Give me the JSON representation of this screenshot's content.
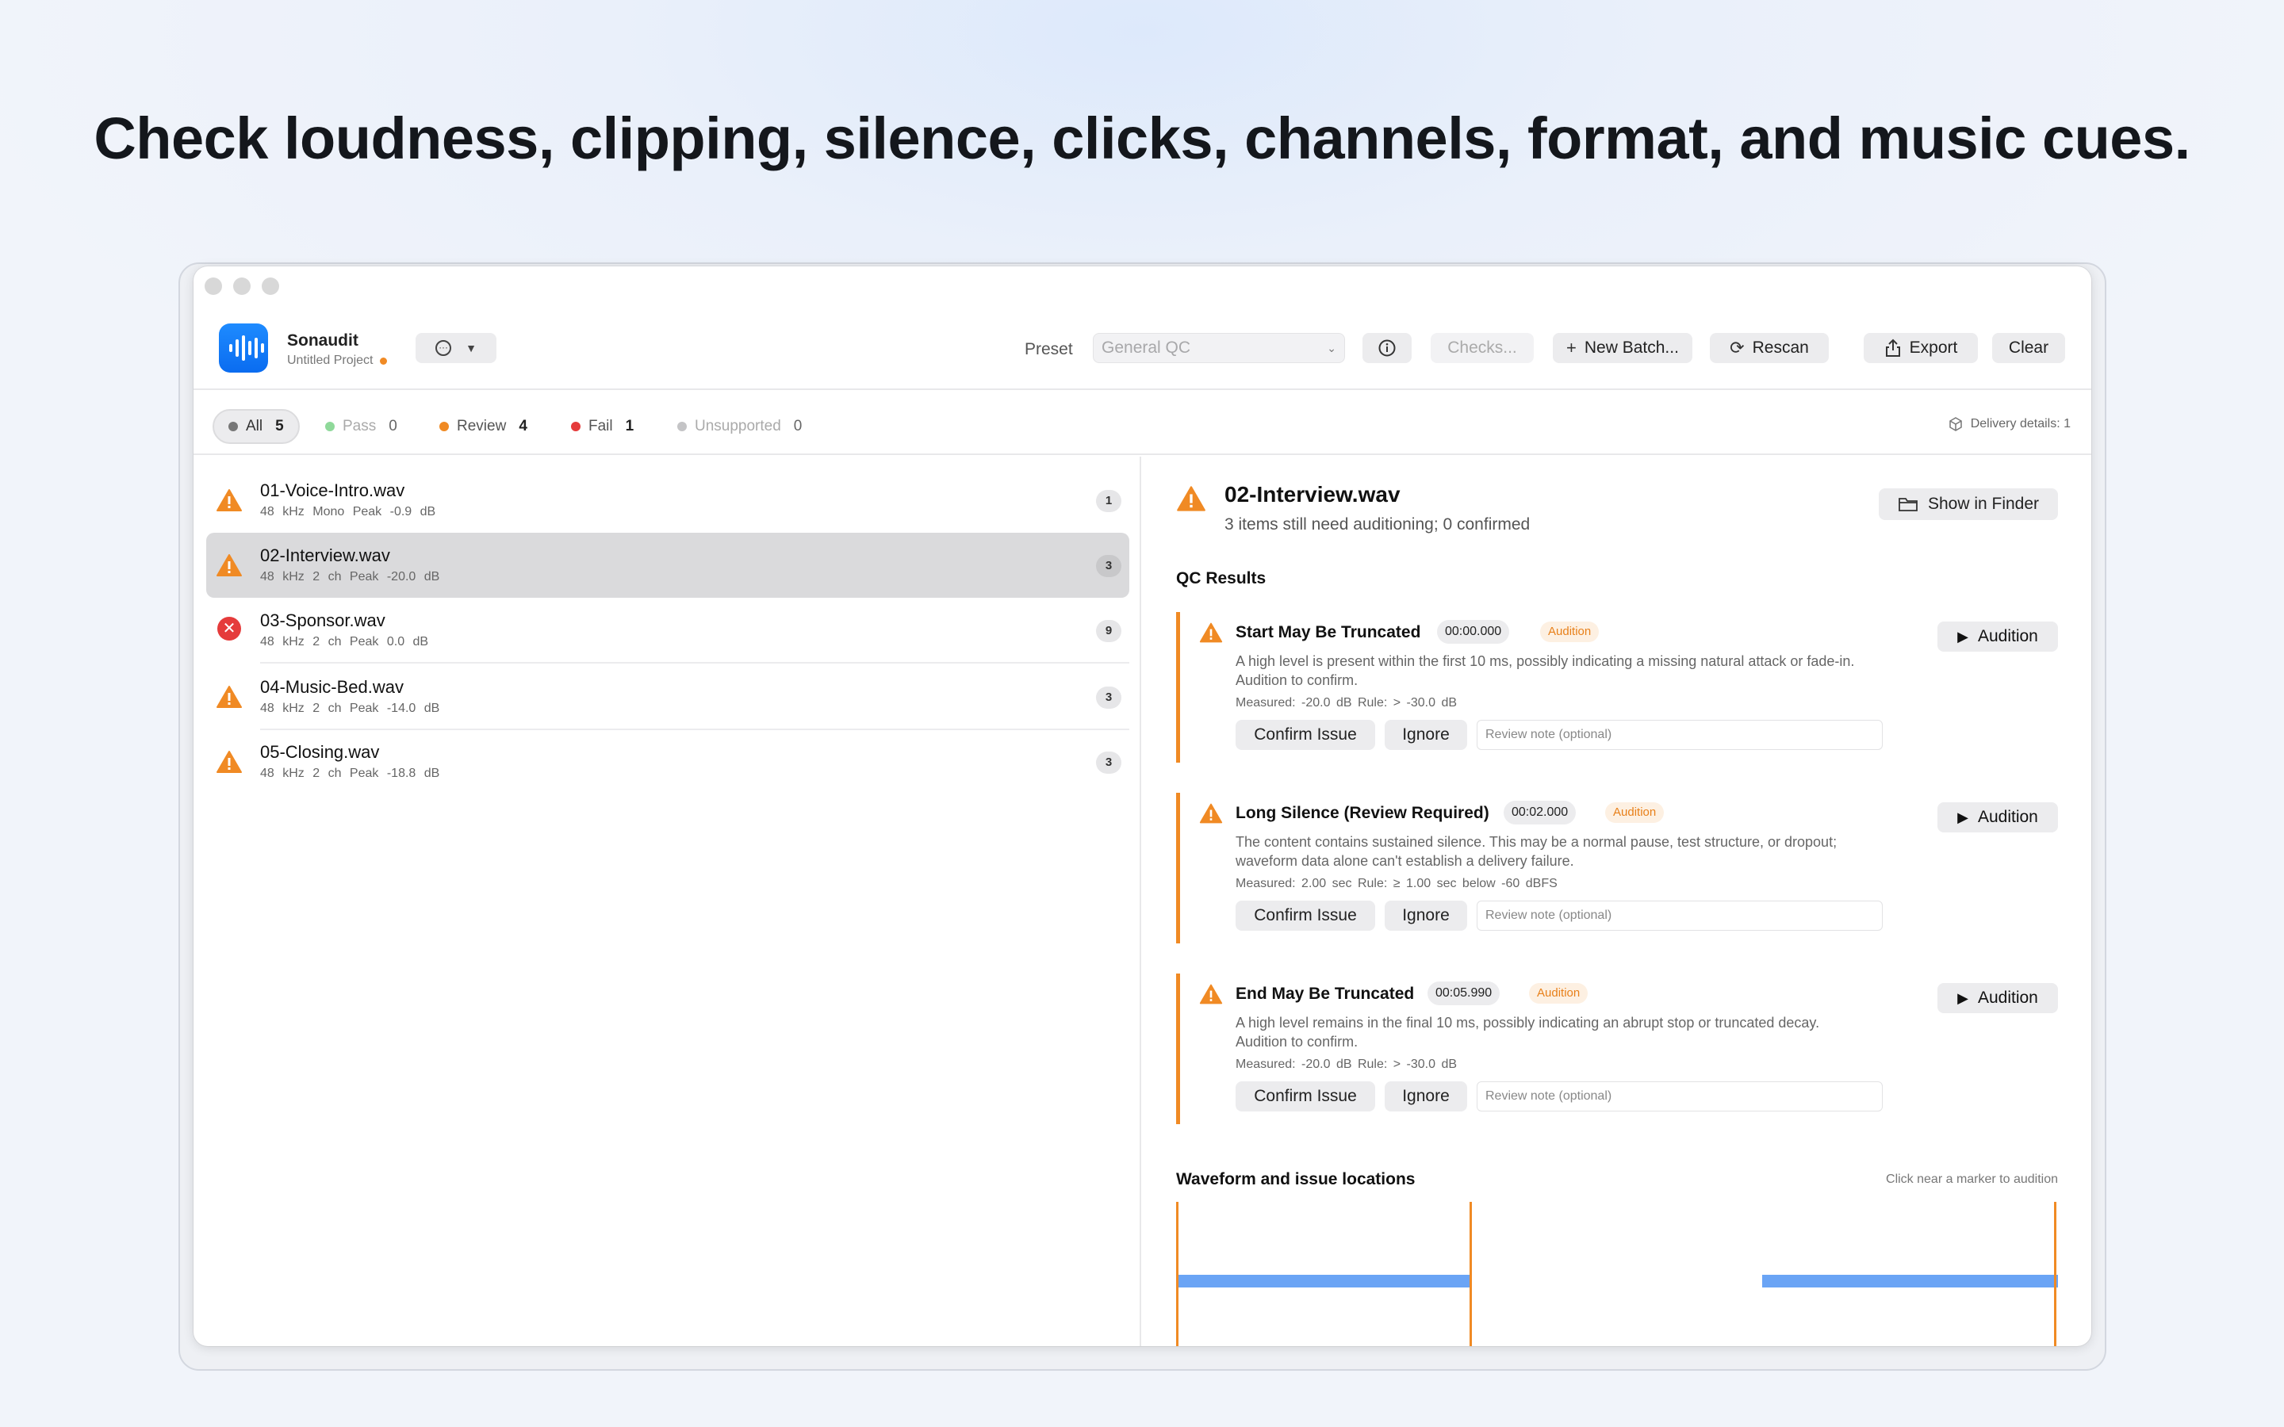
{
  "headline": "Check loudness, clipping, silence, clicks, channels, format, and music cues.",
  "app": {
    "name": "Sonaudit",
    "project": "Untitled Project"
  },
  "toolbar": {
    "preset_label": "Preset",
    "preset_value": "General QC",
    "checks_label": "Checks...",
    "new_batch_label": "New Batch...",
    "rescan_label": "Rescan",
    "export_label": "Export",
    "clear_label": "Clear"
  },
  "filters": [
    {
      "label": "All",
      "count": "5",
      "color": "#777777"
    },
    {
      "label": "Pass",
      "count": "0",
      "color": "#8fd99a"
    },
    {
      "label": "Review",
      "count": "4",
      "color": "#f08a24"
    },
    {
      "label": "Fail",
      "count": "1",
      "color": "#e53b3b"
    },
    {
      "label": "Unsupported",
      "count": "0",
      "color": "#c4c4c6"
    }
  ],
  "delivery_details": "Delivery details: 1",
  "files": [
    {
      "name": "01-Voice-Intro.wav",
      "meta": "48 kHz  Mono  Peak -0.9 dB",
      "count": "1",
      "status": "review"
    },
    {
      "name": "02-Interview.wav",
      "meta": "48 kHz  2 ch  Peak -20.0 dB",
      "count": "3",
      "status": "review"
    },
    {
      "name": "03-Sponsor.wav",
      "meta": "48 kHz  2 ch  Peak 0.0 dB",
      "count": "9",
      "status": "fail"
    },
    {
      "name": "04-Music-Bed.wav",
      "meta": "48 kHz  2 ch  Peak -14.0 dB",
      "count": "3",
      "status": "review"
    },
    {
      "name": "05-Closing.wav",
      "meta": "48 kHz  2 ch  Peak -18.8 dB",
      "count": "3",
      "status": "review"
    }
  ],
  "detail": {
    "title": "02-Interview.wav",
    "subtitle": "3 items still need auditioning; 0 confirmed",
    "show_in_finder": "Show in Finder",
    "qc_results": "QC Results",
    "issues": [
      {
        "title": "Start May Be Truncated",
        "time": "00:00.000",
        "tag": "Audition",
        "desc": "A high level is present within the first 10 ms, possibly indicating a missing natural attack or fade-in. Audition to confirm.",
        "measured": "Measured: -20.0 dB    Rule: > -30.0 dB",
        "confirm": "Confirm Issue",
        "ignore": "Ignore",
        "note_placeholder": "Review note (optional)",
        "audition_button": "Audition"
      },
      {
        "title": "Long Silence (Review Required)",
        "time": "00:02.000",
        "tag": "Audition",
        "desc": "The content contains sustained silence. This may be a normal pause, test structure, or dropout; waveform data alone can't establish a delivery failure.",
        "measured": "Measured: 2.00 sec    Rule: ≥ 1.00 sec below -60 dBFS",
        "confirm": "Confirm Issue",
        "ignore": "Ignore",
        "note_placeholder": "Review note (optional)",
        "audition_button": "Audition"
      },
      {
        "title": "End May Be Truncated",
        "time": "00:05.990",
        "tag": "Audition",
        "desc": "A high level remains in the final 10 ms, possibly indicating an abrupt stop or truncated decay. Audition to confirm.",
        "measured": "Measured: -20.0 dB    Rule: > -30.0 dB",
        "confirm": "Confirm Issue",
        "ignore": "Ignore",
        "note_placeholder": "Review note (optional)",
        "audition_button": "Audition"
      }
    ],
    "waveform_title": "Waveform and issue locations",
    "waveform_hint": "Click near a marker to audition",
    "waveform": {
      "duration_sec": 6.0,
      "markers_sec": [
        0.0,
        2.0,
        5.99
      ],
      "segments_sec": [
        [
          0.0,
          2.0
        ],
        [
          4.0,
          6.0
        ]
      ]
    }
  }
}
